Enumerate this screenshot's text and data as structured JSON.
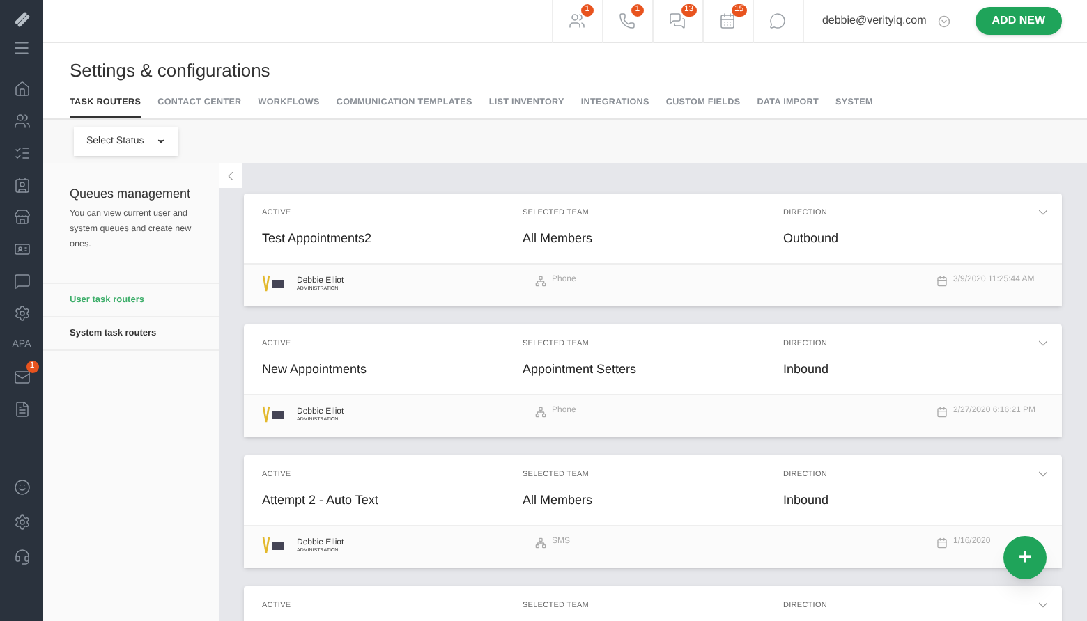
{
  "sidebar": {
    "items": [
      {
        "kind": "icon"
      },
      {
        "kind": "icon"
      },
      {
        "kind": "icon"
      },
      {
        "kind": "icon"
      },
      {
        "kind": "icon"
      },
      {
        "kind": "icon"
      },
      {
        "kind": "icon"
      },
      {
        "kind": "icon"
      },
      {
        "kind": "text",
        "label": "APA"
      },
      {
        "kind": "icon",
        "badge": "1"
      },
      {
        "kind": "icon"
      }
    ]
  },
  "top_bar": {
    "badges": [
      "1",
      "1",
      "13",
      "15"
    ],
    "user_email": "debbie@verityiq.com",
    "add_button": "ADD NEW"
  },
  "page_title": "Settings & configurations",
  "tabs": [
    {
      "label": "TASK ROUTERS",
      "selected": true
    },
    {
      "label": "CONTACT CENTER",
      "selected": false
    },
    {
      "label": "WORKFLOWS",
      "selected": false
    },
    {
      "label": "COMMUNICATION TEMPLATES",
      "selected": false
    },
    {
      "label": "LIST INVENTORY",
      "selected": false
    },
    {
      "label": "INTEGRATIONS",
      "selected": false
    },
    {
      "label": "CUSTOM FIELDS",
      "selected": false
    },
    {
      "label": "DATA IMPORT",
      "selected": false
    },
    {
      "label": "SYSTEM",
      "selected": false
    }
  ],
  "status_filter": {
    "value": "Select Status"
  },
  "left_panel": {
    "title": "Queues management",
    "description": "You can view current user and system queues and create new ones.",
    "items": [
      {
        "label": "User task routers",
        "selected": true
      },
      {
        "label": "System task routers",
        "selected": false
      }
    ]
  },
  "routers": [
    {
      "labels": [
        "ACTIVE",
        "SELECTED TEAM",
        "DIRECTION"
      ],
      "name": "Test Appointments2",
      "team": "All Members",
      "direction": "Outbound",
      "owner": "Debbie Elliot",
      "role": "ADMINISTRATION",
      "channel": "Phone",
      "date": "3/9/2020 11:25:44 AM"
    },
    {
      "labels": [
        "ACTIVE",
        "SELECTED TEAM",
        "DIRECTION"
      ],
      "name": "New Appointments",
      "team": "Appointment Setters",
      "direction": "Inbound",
      "owner": "Debbie Elliot",
      "role": "ADMINISTRATION",
      "channel": "Phone",
      "date": "2/27/2020 6:16:21 PM"
    },
    {
      "labels": [
        "ACTIVE",
        "SELECTED TEAM",
        "DIRECTION"
      ],
      "name": "Attempt 2 - Auto Text",
      "team": "All Members",
      "direction": "Inbound",
      "owner": "Debbie Elliot",
      "role": "ADMINISTRATION",
      "channel": "SMS",
      "date": "1/16/2020"
    },
    {
      "labels": [
        "ACTIVE",
        "SELECTED TEAM",
        "DIRECTION"
      ]
    }
  ],
  "fab": {
    "label": "+"
  }
}
